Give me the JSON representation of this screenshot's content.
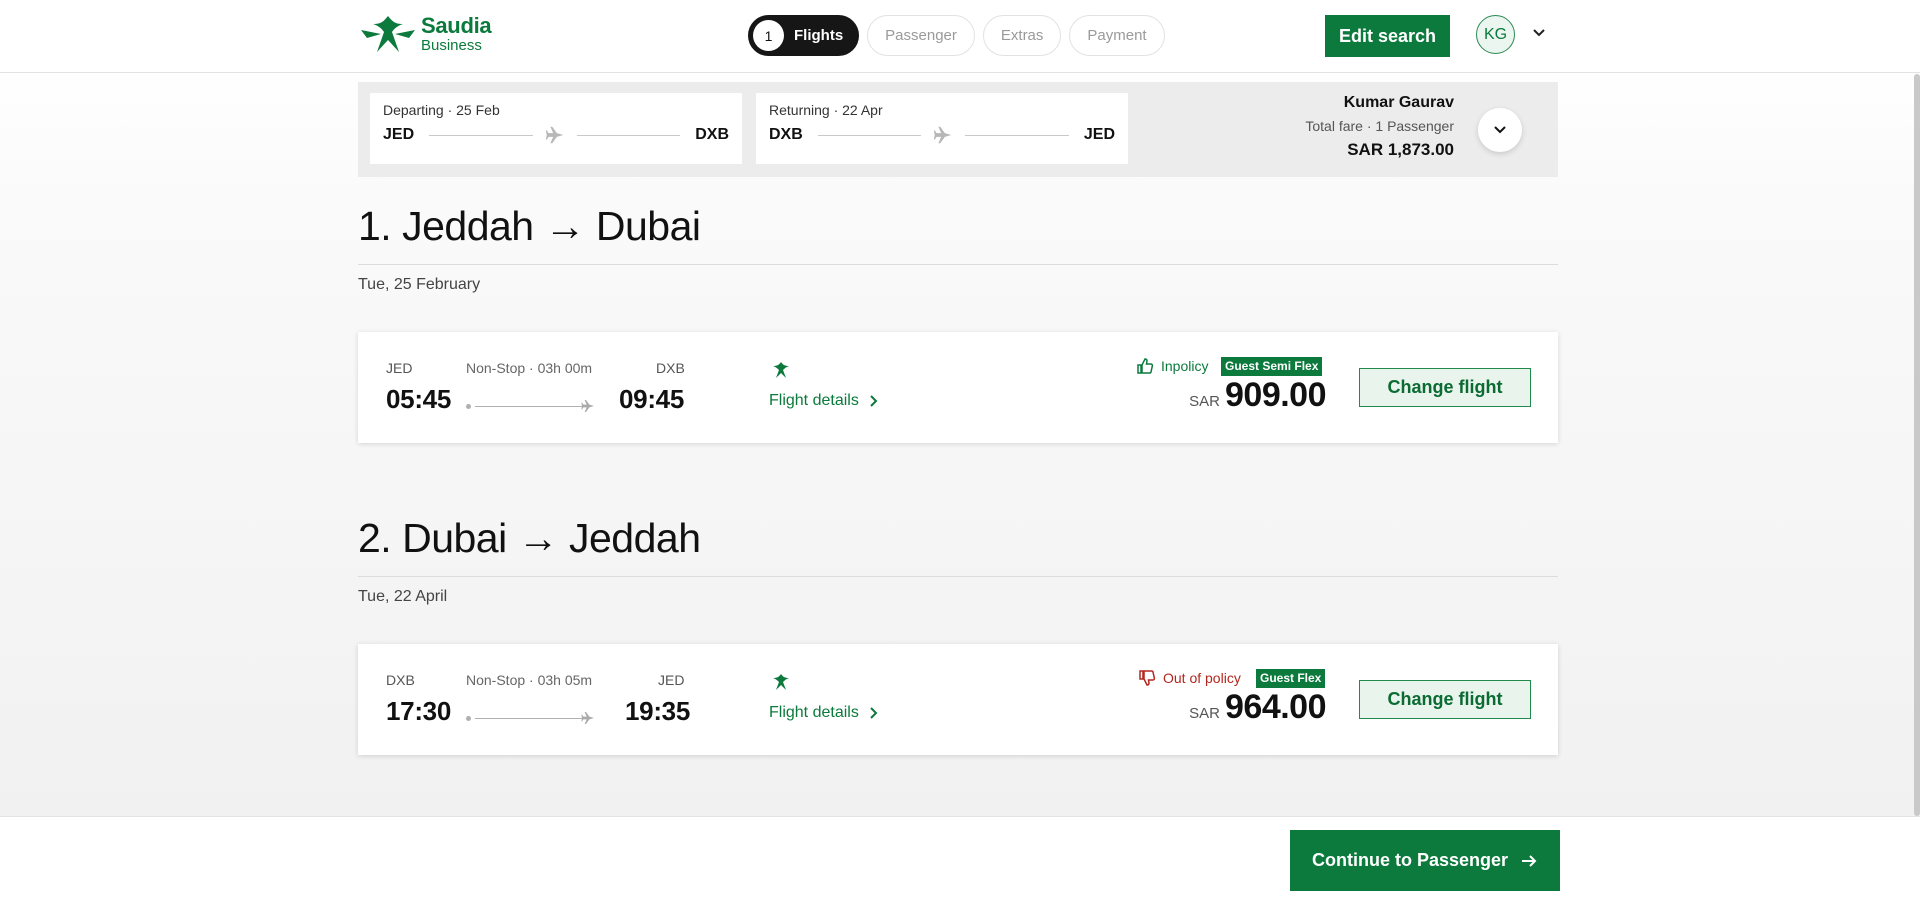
{
  "brand": {
    "name": "Saudia",
    "sub": "Business",
    "color": "#0b7a3c"
  },
  "steps": [
    {
      "num": "1",
      "label": "Flights"
    },
    {
      "label": "Passenger"
    },
    {
      "label": "Extras"
    },
    {
      "label": "Payment"
    }
  ],
  "header": {
    "edit_search": "Edit search",
    "avatar_initials": "KG"
  },
  "summary": {
    "outbound": {
      "label": "Departing · 25 Feb",
      "from": "JED",
      "to": "DXB"
    },
    "return": {
      "label": "Returning · 22 Apr",
      "from": "DXB",
      "to": "JED"
    },
    "passenger_name": "Kumar Gaurav",
    "fare_label": "Total fare · 1 Passenger",
    "total": "SAR 1,873.00"
  },
  "sections": [
    {
      "title": "1. Jeddah → Dubai",
      "date": "Tue, 25 February",
      "flight": {
        "from_code": "JED",
        "to_code": "DXB",
        "duration": "Non-Stop · 03h 00m",
        "dep_time": "05:45",
        "arr_time": "09:45",
        "details_link": "Flight details",
        "policy": "Inpolicy",
        "policy_color": "#0b7a3c",
        "fare_type": "Guest Semi Flex",
        "currency": "SAR",
        "price": "909.00",
        "change_label": "Change flight"
      }
    },
    {
      "title": "2. Dubai → Jeddah",
      "date": "Tue, 22 April",
      "flight": {
        "from_code": "DXB",
        "to_code": "JED",
        "duration": "Non-Stop · 03h 05m",
        "dep_time": "17:30",
        "arr_time": "19:35",
        "details_link": "Flight details",
        "policy": "Out of policy",
        "policy_color": "#b3261e",
        "fare_type": "Guest Flex",
        "currency": "SAR",
        "price": "964.00",
        "change_label": "Change flight"
      }
    }
  ],
  "footer": {
    "continue_label": "Continue to Passenger"
  }
}
